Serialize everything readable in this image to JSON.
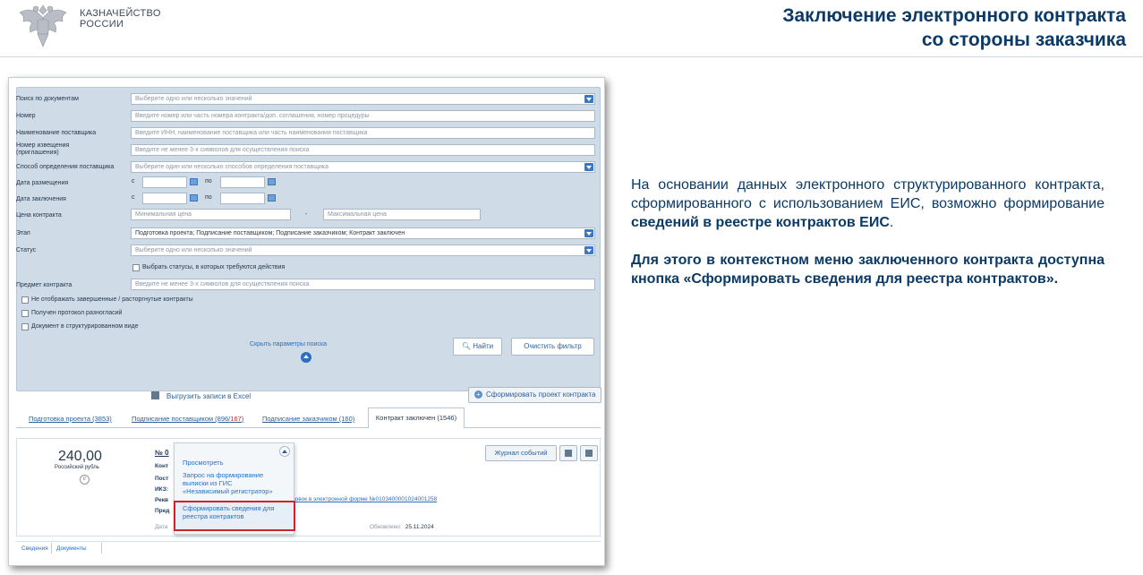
{
  "header": {
    "org_line1": "КАЗНАЧЕЙСТВО",
    "org_line2": "РОССИИ",
    "title_line1": "Заключение электронного контракта",
    "title_line2": "со стороны заказчика"
  },
  "filters": {
    "doc_search": {
      "label": "Поиск по документам",
      "placeholder": "Выберите одно или несколько значений"
    },
    "number": {
      "label": "Номер",
      "placeholder": "Введите номер или часть номера контракта/доп. соглашения, номер процедуры"
    },
    "supplier": {
      "label": "Наименование поставщика",
      "placeholder": "Введите ИНН, наименование поставщика или часть наименования поставщика"
    },
    "notice_label_1": "Номер извещения",
    "notice_label_2": "(приглашения)",
    "notice_placeholder": "Введите не менее 3-х символов для осуществления поиска",
    "method": {
      "label": "Способ определения поставщика",
      "placeholder": "Выберите один или несколько способов определения поставщика"
    },
    "placement_date": {
      "label": "Дата размещения"
    },
    "conclusion_date": {
      "label": "Дата заключения"
    },
    "from": "с",
    "to": "по",
    "price": {
      "label": "Цена контракта",
      "min": "Минимальная цена",
      "dash": "-",
      "max": "Максимальная цена"
    },
    "stage": {
      "label": "Этап",
      "value": "Подготовка проекта; Подписание поставщиком; Подписание заказчиком; Контракт заключен"
    },
    "status": {
      "label": "Статус",
      "placeholder": "Выберите одно или несколько значений"
    },
    "status_action": "Выбрать статусы, в которых требуются действия",
    "subject": {
      "label": "Предмет контракта",
      "placeholder": "Введите не менее 3-х символов для осуществления поиска"
    },
    "hide_finished": "Не отображать завершенные / расторгнутые контракты",
    "disagreement": "Получен протокол разногласий",
    "structured": "Документ в структурированном виде",
    "find_button": "Найти",
    "clear_button": "Очистить фильтр",
    "hide_params": "Скрыть параметры поиска"
  },
  "toolbar": {
    "excel": "Выгрузить записи в Excel",
    "draft": "Сформировать проект контракта"
  },
  "tabs": [
    {
      "label": "Подготовка проекта (3853)"
    },
    {
      "label_prefix": "Подписание поставщиком (896/",
      "label_red": "167",
      "label_suffix": ")"
    },
    {
      "label": "Подписание заказчиком (160)"
    },
    {
      "label": "Контракт заключен (1546)",
      "active": true
    }
  ],
  "card": {
    "price": "240,00",
    "currency": "Российский рубль",
    "number": "№ 0",
    "cut_labels": [
      "Конт",
      "Пост",
      "ИКЗ:",
      "Рекв",
      "Пред"
    ],
    "ikz_tail": "3",
    "procedure_link": "котировок в электронной форме №0103400001024001258",
    "date_label": "Дата",
    "updated_label": "Обновлено:",
    "updated_value": "25.11.2024",
    "journal_button": "Журнал событий"
  },
  "context_menu": {
    "items": [
      "Просмотреть",
      "Запрос на формирование выписки из ГИС «Независимый регистратор»",
      "Сформировать сведения для реестра контрактов"
    ],
    "view": "Просмотреть",
    "request_1": "Запрос на формирование",
    "request_2": "выписки из ГИС",
    "request_3": "«Независимый регистратор»",
    "form_1": "Сформировать сведения для",
    "form_2": "реестра контрактов"
  },
  "bottom_tabs": [
    "Сведения",
    "Документы"
  ],
  "description": {
    "p1_text": "На основании данных электронного структурированного контракта, сформированного с использованием ЕИС, возможно формирование ",
    "p1_bold": "сведений в реестре контрактов ЕИС",
    "p1_end": ".",
    "p2_bold": "Для этого в контекстном меню заключенного контракта доступна кнопка «Сформировать сведения для реестра контрактов»."
  },
  "colors": {
    "title": "#0b3a66",
    "panel": "#cfdbe6",
    "link": "#2c6fc0",
    "highlight_border": "#d3202a"
  }
}
